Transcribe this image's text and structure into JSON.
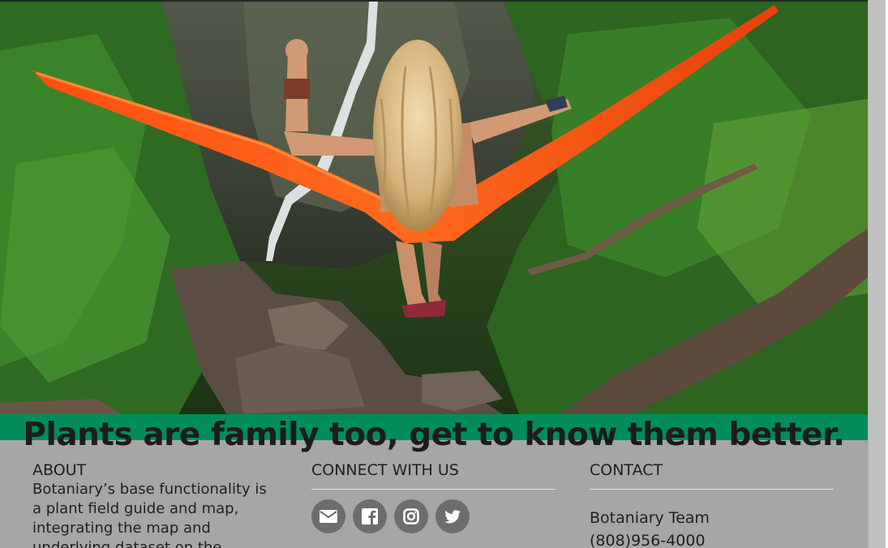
{
  "hero": {
    "image": "woman-in-orange-hammock-rainforest-waterfall"
  },
  "tagline": "Plants are family too, get to know them better.",
  "about": {
    "heading": "ABOUT",
    "text": "Botaniary’s base functionality is a plant field guide and map, integrating the map and underlying dataset on the"
  },
  "connect": {
    "heading": "CONNECT WITH US",
    "icons": [
      "envelope-icon",
      "facebook-icon",
      "instagram-icon",
      "twitter-icon"
    ]
  },
  "contact": {
    "heading": "CONTACT",
    "name": "Botaniary Team",
    "phone": "(808)956-4000"
  },
  "colors": {
    "tagbar": "#008d5a",
    "footer_bg": "#a6a6a6",
    "social_circle": "#6d6d6d",
    "hammock": "#ff5a14"
  }
}
